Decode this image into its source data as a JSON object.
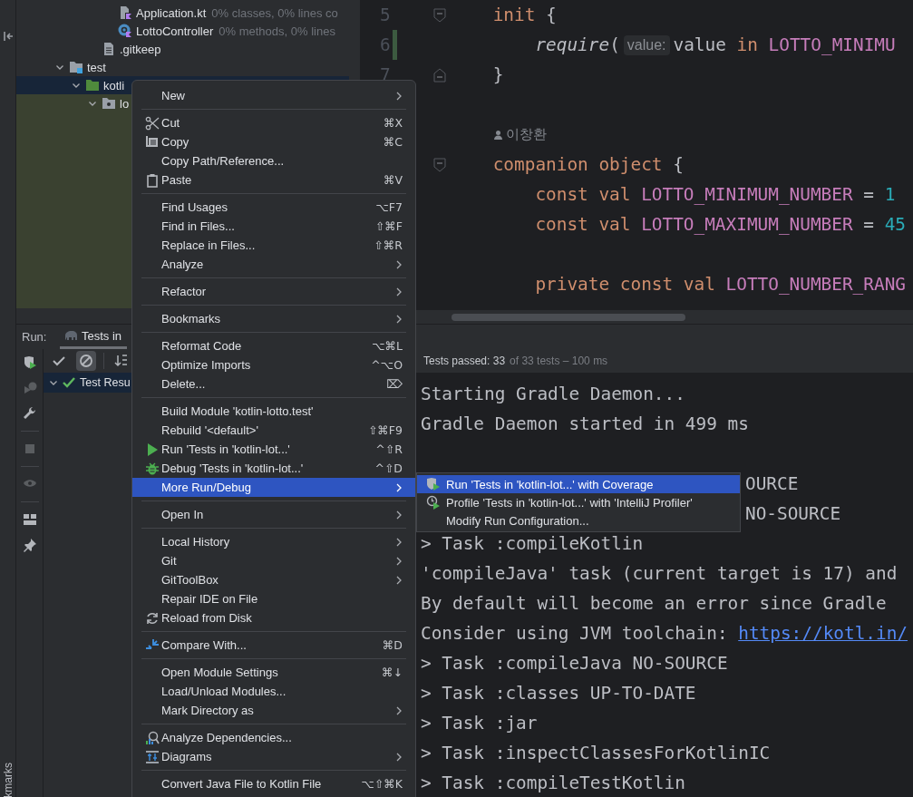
{
  "tool_stripe": {
    "label": "kmarks"
  },
  "project_tree": {
    "items": [
      {
        "kind": "kotlin-file",
        "label": "Application.kt",
        "coverage": "0% classes, 0% lines co"
      },
      {
        "kind": "class",
        "label": "LottoController",
        "coverage": "0% methods, 0% lines"
      },
      {
        "kind": "file",
        "label": ".gitkeep"
      },
      {
        "kind": "test-root",
        "label": "test",
        "expanded": true,
        "selected": false,
        "children": [
          {
            "kind": "source-root",
            "label": "kotli",
            "expanded": true,
            "selected": true,
            "children": [
              {
                "kind": "package",
                "label": "lo",
                "expanded": true,
                "selected": false
              }
            ]
          }
        ]
      }
    ]
  },
  "editor": {
    "lines": [
      {
        "number": "5",
        "fold_start": true,
        "changed": false,
        "tokens": [
          {
            "kind": "keyword",
            "text": "init"
          },
          {
            "kind": "plain",
            "text": " {"
          }
        ],
        "children": [
          {
            "number": "6",
            "changed": true,
            "tokens": [
              {
                "kind": "function",
                "text": "require"
              },
              {
                "kind": "plain",
                "text": "("
              },
              {
                "kind": "hint",
                "text": "value:"
              },
              {
                "kind": "plain",
                "text": "value "
              },
              {
                "kind": "keyword",
                "text": "in"
              },
              {
                "kind": "constant",
                "text": " LOTTO_MINIMU"
              }
            ]
          }
        ]
      },
      {
        "number": "7",
        "fold_end": true,
        "changed": false,
        "tokens": [
          {
            "kind": "plain",
            "text": "}"
          }
        ]
      },
      {
        "changed": false
      },
      {
        "tokens": [
          {
            "kind": "author",
            "text": "이창환"
          }
        ]
      },
      {
        "fold_start": true,
        "tokens": [
          {
            "kind": "keyword",
            "text": "companion object"
          },
          {
            "kind": "plain",
            "text": " {"
          }
        ],
        "children": [
          {
            "tokens": [
              {
                "kind": "keyword",
                "text": "const val "
              },
              {
                "kind": "constant",
                "text": "LOTTO_MINIMUM_NUMBER"
              },
              {
                "kind": "plain",
                "text": " = "
              },
              {
                "kind": "number",
                "text": "1"
              }
            ]
          },
          {
            "tokens": [
              {
                "kind": "keyword",
                "text": "const val "
              },
              {
                "kind": "constant",
                "text": "LOTTO_MAXIMUM_NUMBER"
              },
              {
                "kind": "plain",
                "text": " = "
              },
              {
                "kind": "number",
                "text": "45"
              }
            ]
          },
          {
            "changed": false
          },
          {
            "tokens": [
              {
                "kind": "keyword",
                "text": "private const val "
              },
              {
                "kind": "constant",
                "text": "LOTTO_NUMBER_RANG"
              }
            ]
          }
        ]
      }
    ]
  },
  "run_panel": {
    "label": "Run:",
    "tabs": [
      {
        "label": "Tests in",
        "selected": true
      }
    ],
    "side_tools": [
      {
        "disabled": false
      },
      {
        "disabled": true
      },
      {
        "disabled": false
      },
      {
        "disabled": true
      },
      {
        "disabled": true
      },
      {
        "disabled": false
      },
      {
        "disabled": false
      }
    ],
    "toggles": [
      {
        "on": false
      },
      {
        "on": true
      },
      {
        "on": false
      }
    ],
    "results": [
      {
        "label": "Test Resu",
        "passed": true,
        "expanded": true,
        "selected": true
      }
    ],
    "status": {
      "passed": "Tests passed: 33",
      "total": "of 33 tests – 100 ms"
    },
    "console": [
      {
        "kind": "full",
        "text": "Starting Gradle Daemon..."
      },
      {
        "kind": "full",
        "text": "Gradle Daemon started in 499 ms"
      },
      {
        "kind": "blank"
      },
      {
        "kind": "partial",
        "text": "OURCE"
      },
      {
        "kind": "partial",
        "text": "NO-SOURCE"
      },
      {
        "kind": "full",
        "text": "> Task :compileKotlin"
      },
      {
        "kind": "full",
        "text": "'compileJava' task (current target is 17) and"
      },
      {
        "kind": "full",
        "text": "By default will become an error since Gradle"
      },
      {
        "kind": "link",
        "text": "Consider using JVM toolchain: ",
        "link": "https://kotl.in/"
      },
      {
        "kind": "full",
        "text": "> Task :compileJava NO-SOURCE"
      },
      {
        "kind": "full",
        "text": "> Task :classes UP-TO-DATE"
      },
      {
        "kind": "full",
        "text": "> Task :jar"
      },
      {
        "kind": "full",
        "text": "> Task :inspectClassesForKotlinIC"
      },
      {
        "kind": "full",
        "text": "> Task :compileTestKotlin"
      }
    ]
  },
  "context_menu": {
    "groups": [
      [
        {
          "label": "New",
          "submenu": true,
          "selected": false
        }
      ],
      [
        {
          "label": "Cut",
          "shortcut": "⌘X",
          "submenu": false,
          "selected": false
        },
        {
          "label": "Copy",
          "shortcut": "⌘C",
          "submenu": false,
          "selected": false
        },
        {
          "label": "Copy Path/Reference...",
          "submenu": false,
          "selected": false
        },
        {
          "label": "Paste",
          "shortcut": "⌘V",
          "submenu": false,
          "selected": false
        }
      ],
      [
        {
          "label": "Find Usages",
          "shortcut": "⌥F7",
          "submenu": false,
          "selected": false
        },
        {
          "label": "Find in Files...",
          "shortcut": "⇧⌘F",
          "submenu": false,
          "selected": false
        },
        {
          "label": "Replace in Files...",
          "shortcut": "⇧⌘R",
          "submenu": false,
          "selected": false
        },
        {
          "label": "Analyze",
          "submenu": true,
          "selected": false
        }
      ],
      [
        {
          "label": "Refactor",
          "submenu": true,
          "selected": false
        }
      ],
      [
        {
          "label": "Bookmarks",
          "submenu": true,
          "selected": false
        }
      ],
      [
        {
          "label": "Reformat Code",
          "shortcut": "⌥⌘L",
          "submenu": false,
          "selected": false
        },
        {
          "label": "Optimize Imports",
          "shortcut": "^⌥O",
          "submenu": false,
          "selected": false
        },
        {
          "label": "Delete...",
          "shortcut": "⌦",
          "submenu": false,
          "selected": false
        }
      ],
      [
        {
          "label": "Build Module 'kotlin-lotto.test'",
          "submenu": false,
          "selected": false
        },
        {
          "label": "Rebuild '<default>'",
          "shortcut": "⇧⌘F9",
          "submenu": false,
          "selected": false
        },
        {
          "label": "Run 'Tests in 'kotlin-lot...'",
          "shortcut": "^⇧R",
          "submenu": false,
          "selected": false
        },
        {
          "label": "Debug 'Tests in 'kotlin-lot...'",
          "shortcut": "^⇧D",
          "submenu": false,
          "selected": false
        },
        {
          "label": "More Run/Debug",
          "submenu": true,
          "selected": true
        }
      ],
      [
        {
          "label": "Open In",
          "submenu": true,
          "selected": false
        }
      ],
      [
        {
          "label": "Local History",
          "submenu": true,
          "selected": false
        },
        {
          "label": "Git",
          "submenu": true,
          "selected": false
        },
        {
          "label": "GitToolBox",
          "submenu": true,
          "selected": false
        },
        {
          "label": "Repair IDE on File",
          "submenu": false,
          "selected": false
        },
        {
          "label": "Reload from Disk",
          "submenu": false,
          "selected": false
        }
      ],
      [
        {
          "label": "Compare With...",
          "shortcut": "⌘D",
          "submenu": false,
          "selected": false
        }
      ],
      [
        {
          "label": "Open Module Settings",
          "shortcut": "⌘↓",
          "submenu": false,
          "selected": false
        },
        {
          "label": "Load/Unload Modules...",
          "submenu": false,
          "selected": false
        },
        {
          "label": "Mark Directory as",
          "submenu": true,
          "selected": false
        }
      ],
      [
        {
          "label": "Analyze Dependencies...",
          "submenu": false,
          "selected": false
        },
        {
          "label": "Diagrams",
          "submenu": true,
          "selected": false
        }
      ],
      [
        {
          "label": "Convert Java File to Kotlin File",
          "shortcut": "⌥⇧⌘K",
          "submenu": false,
          "selected": false
        }
      ]
    ]
  },
  "submenu": {
    "items": [
      {
        "label": "Run 'Tests in 'kotlin-lot...' with Coverage",
        "selected": true
      },
      {
        "label": "Profile 'Tests in 'kotlin-lot...' with 'IntelliJ Profiler'",
        "selected": false
      },
      {
        "label": "Modify Run Configuration...",
        "selected": false
      }
    ]
  }
}
